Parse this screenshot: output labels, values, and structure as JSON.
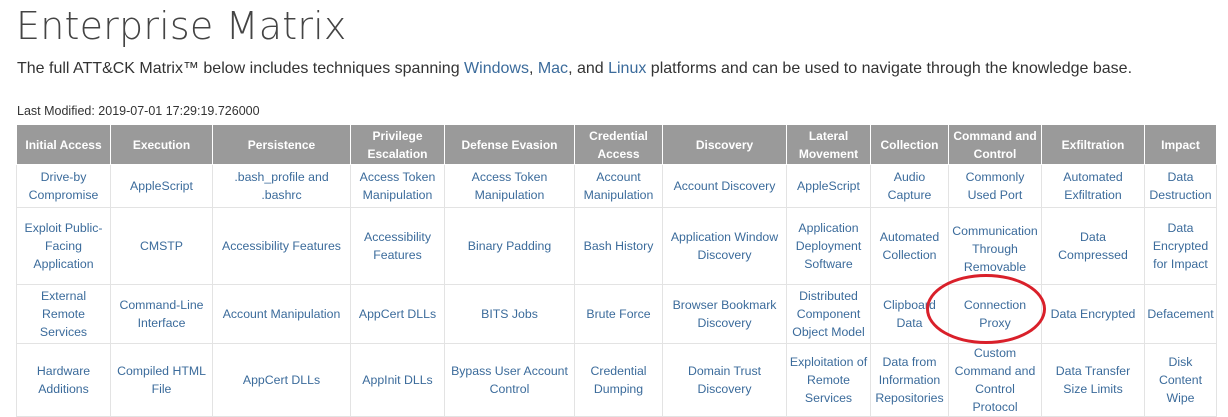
{
  "title": "Enterprise Matrix",
  "intro": {
    "before": "The full ATT&CK Matrix™ below includes techniques spanning ",
    "platforms": [
      "Windows",
      "Mac",
      "Linux"
    ],
    "sep1": ", ",
    "sep2": ", and ",
    "after": " platforms and can be used to navigate through the knowledge base."
  },
  "last_modified": "Last Modified: 2019-07-01 17:29:19.726000",
  "columns": [
    "Initial Access",
    "Execution",
    "Persistence",
    "Privilege Escalation",
    "Defense Evasion",
    "Credential Access",
    "Discovery",
    "Lateral Movement",
    "Collection",
    "Command and Control",
    "Exfiltration",
    "Impact"
  ],
  "rows": [
    [
      "Drive-by Compromise",
      "AppleScript",
      ".bash_profile and .bashrc",
      "Access Token Manipulation",
      "Access Token Manipulation",
      "Account Manipulation",
      "Account Discovery",
      "AppleScript",
      "Audio Capture",
      "Commonly Used Port",
      "Automated Exfiltration",
      "Data Destruction"
    ],
    [
      "Exploit Public-Facing Application",
      "CMSTP",
      "Accessibility Features",
      "Accessibility Features",
      "Binary Padding",
      "Bash History",
      "Application Window Discovery",
      "Application Deployment Software",
      "Automated Collection",
      "Communication Through Removable Media",
      "Data Compressed",
      "Data Encrypted for Impact"
    ],
    [
      "External Remote Services",
      "Command-Line Interface",
      "Account Manipulation",
      "AppCert DLLs",
      "BITS Jobs",
      "Brute Force",
      "Browser Bookmark Discovery",
      "Distributed Component Object Model",
      "Clipboard Data",
      "Connection Proxy",
      "Data Encrypted",
      "Defacement"
    ],
    [
      "Hardware Additions",
      "Compiled HTML File",
      "AppCert DLLs",
      "AppInit DLLs",
      "Bypass User Account Control",
      "Credential Dumping",
      "Domain Trust Discovery",
      "Exploitation of Remote Services",
      "Data from Information Repositories",
      "Custom Command and Control Protocol",
      "Data Transfer Size Limits",
      "Disk Content Wipe"
    ]
  ],
  "highlight_color": "#d9202a",
  "link_color": "#3b6b9b",
  "header_bg": "#9a9a9a"
}
